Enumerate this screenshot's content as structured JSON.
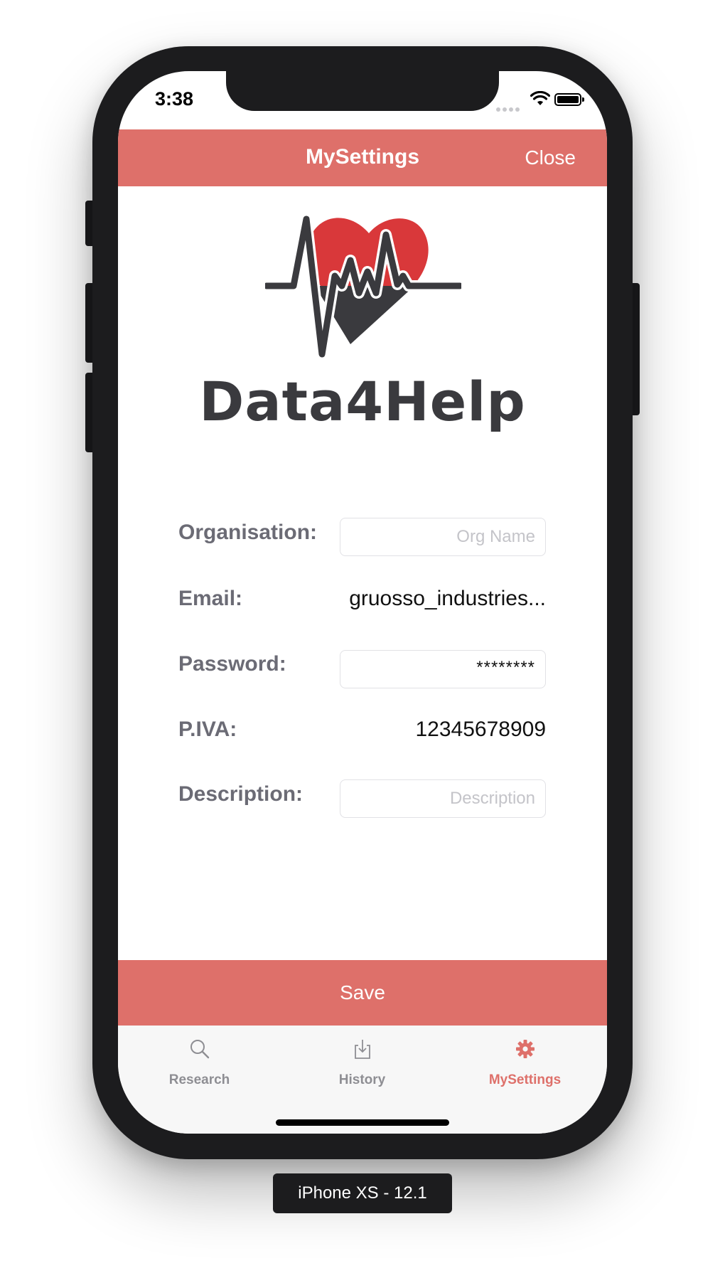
{
  "status_bar": {
    "time": "3:38"
  },
  "navbar": {
    "title": "MySettings",
    "close_label": "Close"
  },
  "logo": {
    "text": "Data4Help"
  },
  "form": {
    "organisation": {
      "label": "Organisation:",
      "placeholder": "Org Name",
      "value": ""
    },
    "email": {
      "label": "Email:",
      "value": "gruosso_industries..."
    },
    "password": {
      "label": "Password:",
      "value": "********"
    },
    "piva": {
      "label": "P.IVA:",
      "value": "12345678909"
    },
    "description": {
      "label": "Description:",
      "placeholder": "Description",
      "value": ""
    }
  },
  "save_label": "Save",
  "tabs": [
    {
      "label": "Research",
      "icon": "search-icon"
    },
    {
      "label": "History",
      "icon": "download-tray-icon"
    },
    {
      "label": "MySettings",
      "icon": "gear-icon",
      "active": true
    }
  ],
  "simulator_label": "iPhone XS - 12.1",
  "colors": {
    "accent": "#de706a",
    "heart_red": "#d9383a",
    "dark": "#3a3a3e"
  }
}
